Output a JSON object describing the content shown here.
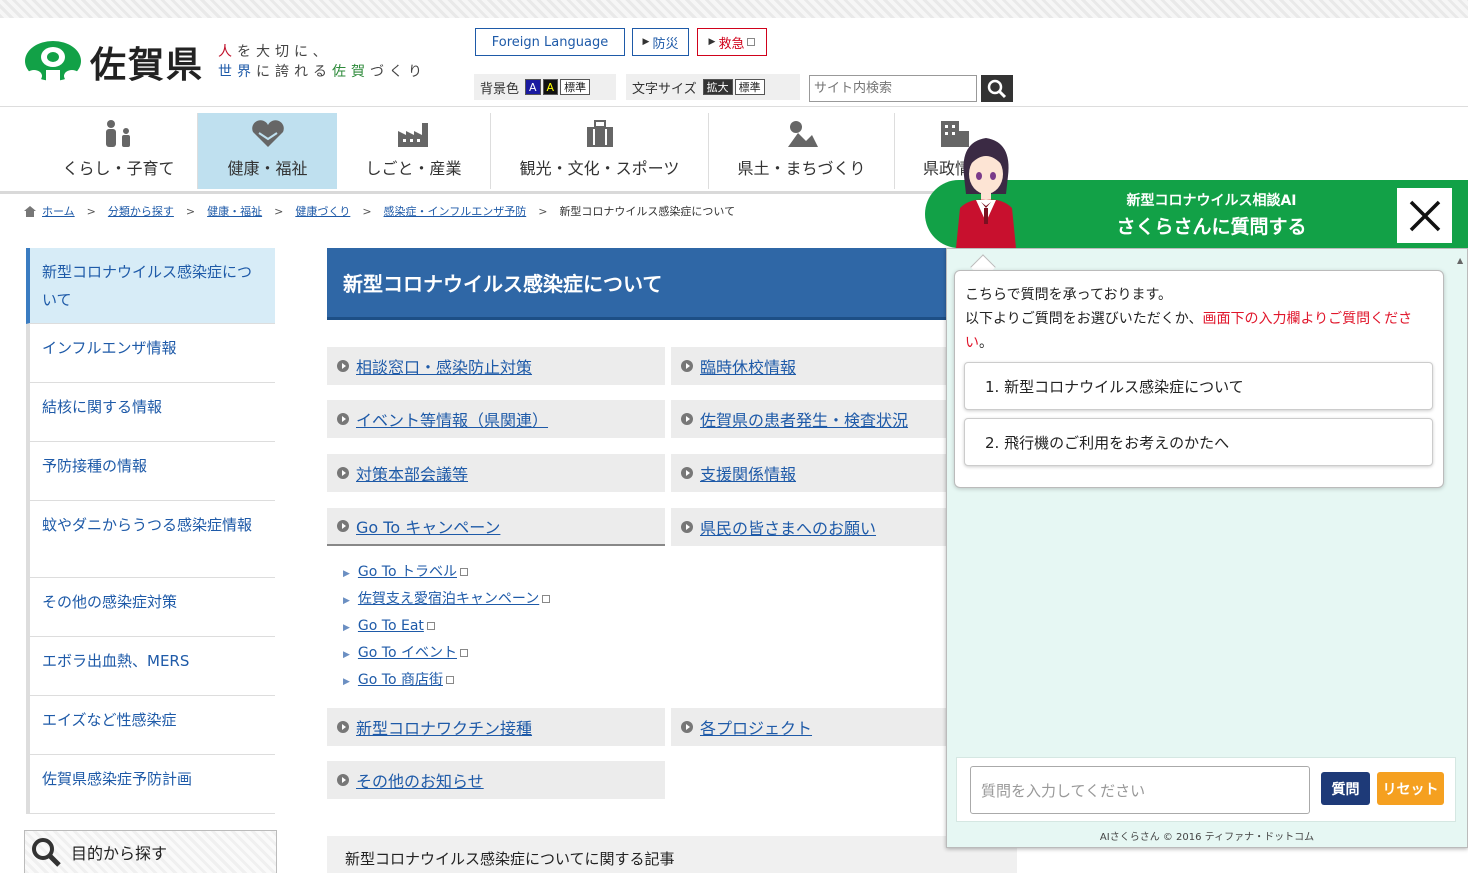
{
  "header": {
    "logo_name": "佐賀県",
    "tagline_line1": [
      "人",
      "を大切に、"
    ],
    "tagline_line2": [
      "世界",
      "に誇れる",
      "佐賀",
      "づくり"
    ],
    "foreign_language": "Foreign Language",
    "disaster": "防災",
    "emergency": "救急",
    "bg_color_label": "背景色",
    "bg_a1": "A",
    "bg_a2": "A",
    "bg_standard": "標準",
    "font_size_label": "文字サイズ",
    "font_large": "拡大",
    "font_standard": "標準",
    "search_placeholder": "サイト内検索"
  },
  "nav": [
    {
      "label": "くらし・子育て",
      "icon": "family-icon"
    },
    {
      "label": "健康・福祉",
      "icon": "heart-hands-icon"
    },
    {
      "label": "しごと・産業",
      "icon": "factory-icon"
    },
    {
      "label": "観光・文化・スポーツ",
      "icon": "suitcase-icon"
    },
    {
      "label": "県土・まちづくり",
      "icon": "landscape-icon"
    },
    {
      "label": "県政情報",
      "icon": "building-icon"
    }
  ],
  "breadcrumb": [
    "ホーム",
    "分類から探す",
    "健康・福祉",
    "健康づくり",
    "感染症・インフルエンザ予防",
    "新型コロナウイルス感染症について"
  ],
  "sidebar": {
    "items": [
      "新型コロナウイルス感染症について",
      "インフルエンザ情報",
      "結核に関する情報",
      "予防接種の情報",
      "蚊やダニからうつる感染症情報",
      "その他の感染症対策",
      "エボラ出血熱、MERS",
      "エイズなど性感染症",
      "佐賀県感染症予防計画"
    ],
    "purpose_search": "目的から探す"
  },
  "main": {
    "title": "新型コロナウイルス感染症について",
    "links_left": [
      "相談窓口・感染防止対策",
      "イベント等情報（県関連）",
      "対策本部会議等",
      "Go To キャンペーン",
      "新型コロナワクチン接種",
      "その他のお知らせ"
    ],
    "links_right": [
      "臨時休校情報",
      "佐賀県の患者発生・検査状況",
      "支援関係情報",
      "県民の皆さまへのお願い",
      "各プロジェクト"
    ],
    "goto_sublinks": [
      "Go To トラベル",
      "佐賀支え愛宿泊キャンペーン",
      "Go To Eat",
      "Go To イベント",
      "Go To 商店街"
    ],
    "articles_heading": "新型コロナウイルス感染症についてに関する記事"
  },
  "chat": {
    "header_line1": "新型コロナウイルス相談AI",
    "header_line2": "さくらさんに質問する",
    "greeting1": "こちらで質問を承っております。",
    "greeting2": "以下よりご質問をお選びいただくか、",
    "greeting_red": "画面下の入力欄よりご質問ください",
    "greeting_end": "。",
    "options": [
      "1. 新型コロナウイルス感染症について",
      "2. 飛行機のご利用をお考えのかたへ"
    ],
    "input_placeholder": "質問を入力してください",
    "ask_button": "質問",
    "reset_button": "リセット",
    "copyright": "AIさくらさん © 2016 ティファナ・ドットコム"
  },
  "colors": {
    "brand_green": "#12a147",
    "link_blue": "#1e5aa8",
    "title_blue": "#2f67a6",
    "nav_active": "#bfe0ef",
    "emphasis_red": "#e0162b",
    "ask_navy": "#1e3a78",
    "reset_orange": "#f5a020"
  }
}
